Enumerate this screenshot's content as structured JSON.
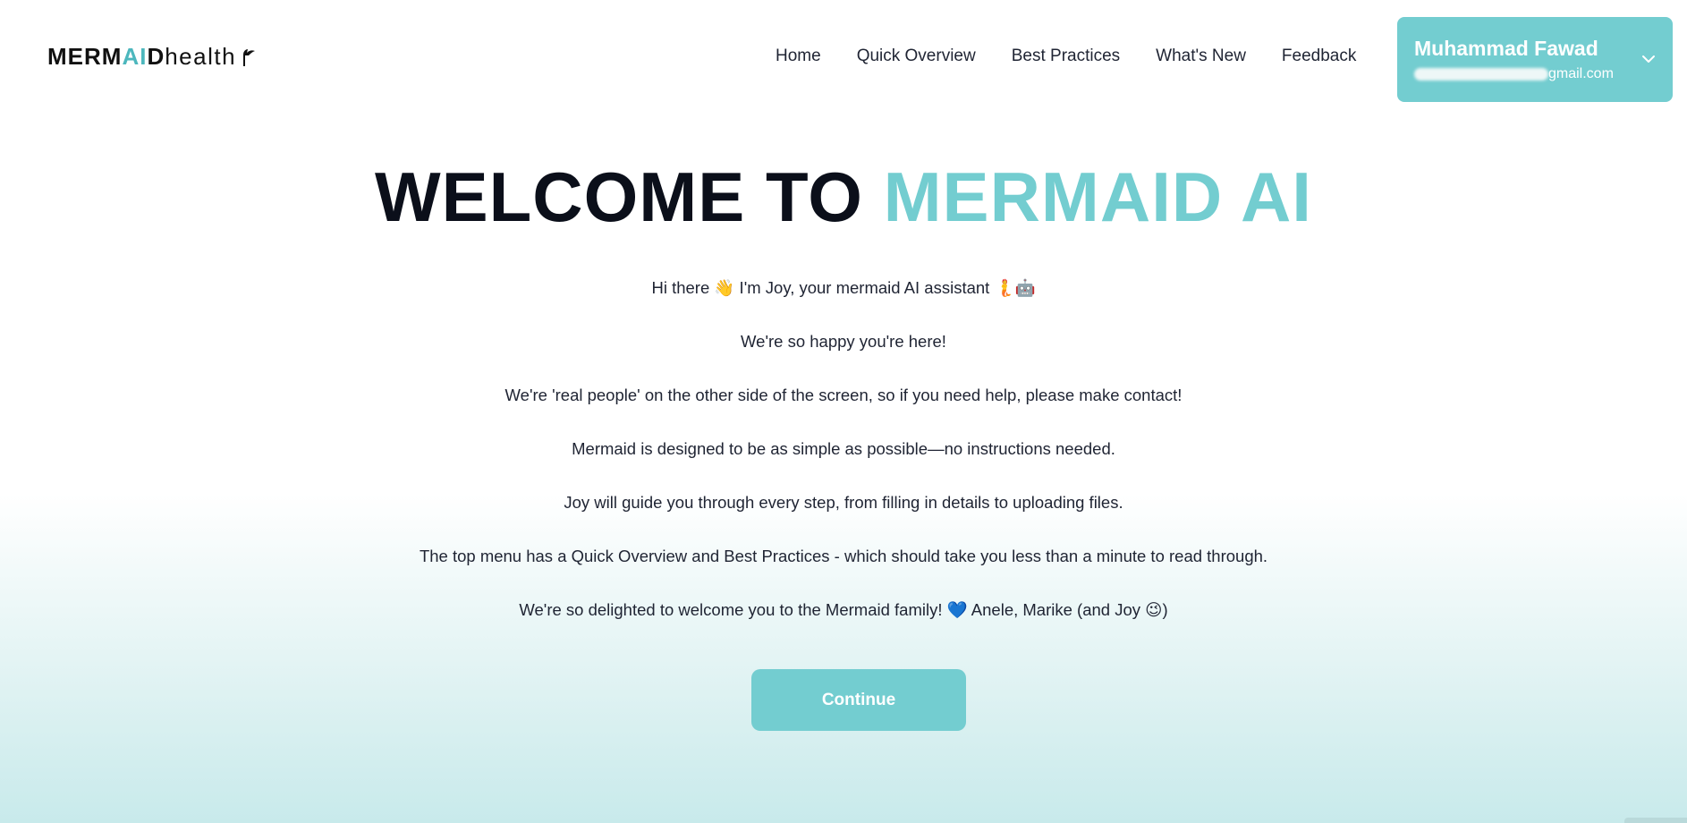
{
  "brand": {
    "logo_strong": "MERM",
    "logo_accent": "AI",
    "logo_strong2": "D",
    "logo_light": "health",
    "accent_color": "#73cdd0",
    "logo_accent_color": "#4cb7bd"
  },
  "nav": {
    "items": [
      {
        "label": "Home"
      },
      {
        "label": "Quick Overview"
      },
      {
        "label": "Best Practices"
      },
      {
        "label": "What's New"
      },
      {
        "label": "Feedback"
      }
    ]
  },
  "user": {
    "name": "Muhammad Fawad",
    "email_suffix": "gmail.com",
    "menu_icon": "chevron-down-icon"
  },
  "hero": {
    "title_dark": "WELCOME TO ",
    "title_accent": "MERMAID AI"
  },
  "intro": {
    "p1_a": "Hi there ",
    "p1_wave": "👋",
    "p1_b": " I'm Joy, your mermaid AI assistant ",
    "p1_emoji1": "🧜",
    "p1_emoji2": "🤖",
    "p2": "We're so happy you're here!",
    "p3": "We're 'real people' on the other side of the screen, so if you need help, please make contact!",
    "p4": "Mermaid is designed to be as simple as possible—no instructions needed.",
    "p5": "Joy will guide you through every step, from filling in details to uploading files.",
    "p6": "The top menu has a Quick Overview and Best Practices - which should take you less than a minute to read through.",
    "p7_a": "We're so delighted to welcome you to the Mermaid family! ",
    "p7_heart": "💙",
    "p7_b": " Anele, Marike (and Joy ",
    "p7_smile": "😉",
    "p7_c": ")"
  },
  "actions": {
    "continue_label": "Continue"
  }
}
